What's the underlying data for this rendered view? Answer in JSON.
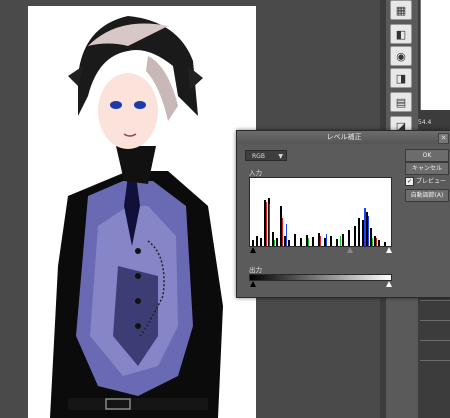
{
  "dialog": {
    "title": "レベル補正",
    "close_glyph": "✕",
    "channel": "RGB",
    "channel_arrow": "▼",
    "input_label": "入力",
    "output_label": "出力",
    "ok_label": "OK",
    "cancel_label": "キャンセル",
    "preview_label": "プレビュー(P)",
    "preview_checked": true,
    "auto_label": "自動調節(A)"
  },
  "side": {
    "panel_value": "54.4"
  },
  "tools": [
    {
      "icon": "checker-icon",
      "glyph": "▦"
    },
    {
      "icon": "layers-icon",
      "glyph": "◧"
    },
    {
      "icon": "layer-gear-icon",
      "glyph": "◉"
    },
    {
      "icon": "layer-copy-icon",
      "glyph": "◨"
    },
    {
      "icon": "layer-group-icon",
      "glyph": "▤"
    },
    {
      "icon": "layer-mask-icon",
      "glyph": "◪"
    }
  ],
  "colors": {
    "dialog_bg": "#5b5b5b",
    "hist_black": "#000000",
    "hist_red": "#e02020",
    "hist_green": "#20c020",
    "hist_blue": "#2040ff"
  }
}
